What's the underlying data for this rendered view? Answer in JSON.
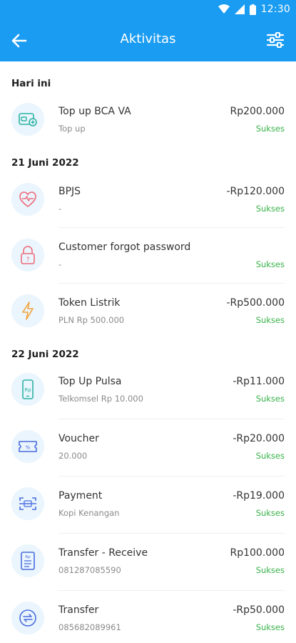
{
  "status_bar": {
    "time": "12:30",
    "icons": [
      "wifi-icon",
      "signal-icon",
      "battery-icon"
    ]
  },
  "header": {
    "title": "Aktivitas",
    "back_icon": "arrow-left-icon",
    "filter_icon": "sliders-icon",
    "color": "#1a9cf2"
  },
  "sections": [
    {
      "heading": "Hari ini",
      "items": [
        {
          "title": "Top up BCA VA",
          "subtitle": "Top up",
          "amount": "Rp200.000",
          "status": "Sukses",
          "icon": "wallet-topup-icon"
        }
      ]
    },
    {
      "heading": "21 Juni 2022",
      "items": [
        {
          "title": "BPJS",
          "subtitle": "-",
          "amount": "-Rp120.000",
          "status": "Sukses",
          "icon": "heart-pulse-icon"
        },
        {
          "title": "Customer forgot password",
          "subtitle": "-",
          "amount": "",
          "status": "Sukses",
          "icon": "lock-icon"
        },
        {
          "title": "Token Listrik",
          "subtitle": "PLN Rp 500.000",
          "amount": "-Rp500.000",
          "status": "Sukses",
          "icon": "lightning-icon"
        }
      ]
    },
    {
      "heading": "22 Juni 2022",
      "items": [
        {
          "title": "Top Up Pulsa",
          "subtitle": "Telkomsel Rp 10.000",
          "amount": "-Rp11.000",
          "status": "Sukses",
          "icon": "phone-icon"
        },
        {
          "title": "Voucher",
          "subtitle": "20.000",
          "amount": "-Rp20.000",
          "status": "Sukses",
          "icon": "voucher-icon"
        },
        {
          "title": "Payment",
          "subtitle": "Kopi Kenangan",
          "amount": "-Rp19.000",
          "status": "Sukses",
          "icon": "scan-icon"
        },
        {
          "title": "Transfer - Receive",
          "subtitle": "081287085590",
          "amount": "Rp100.000",
          "status": "Sukses",
          "icon": "receipt-icon"
        },
        {
          "title": "Transfer",
          "subtitle": "085682089961",
          "amount": "-Rp50.000",
          "status": "Sukses",
          "icon": "transfer-icon"
        }
      ]
    }
  ],
  "colors": {
    "accent": "#1a9cf2",
    "success": "#38b24a",
    "icon_bg": "#eaf5fd"
  }
}
